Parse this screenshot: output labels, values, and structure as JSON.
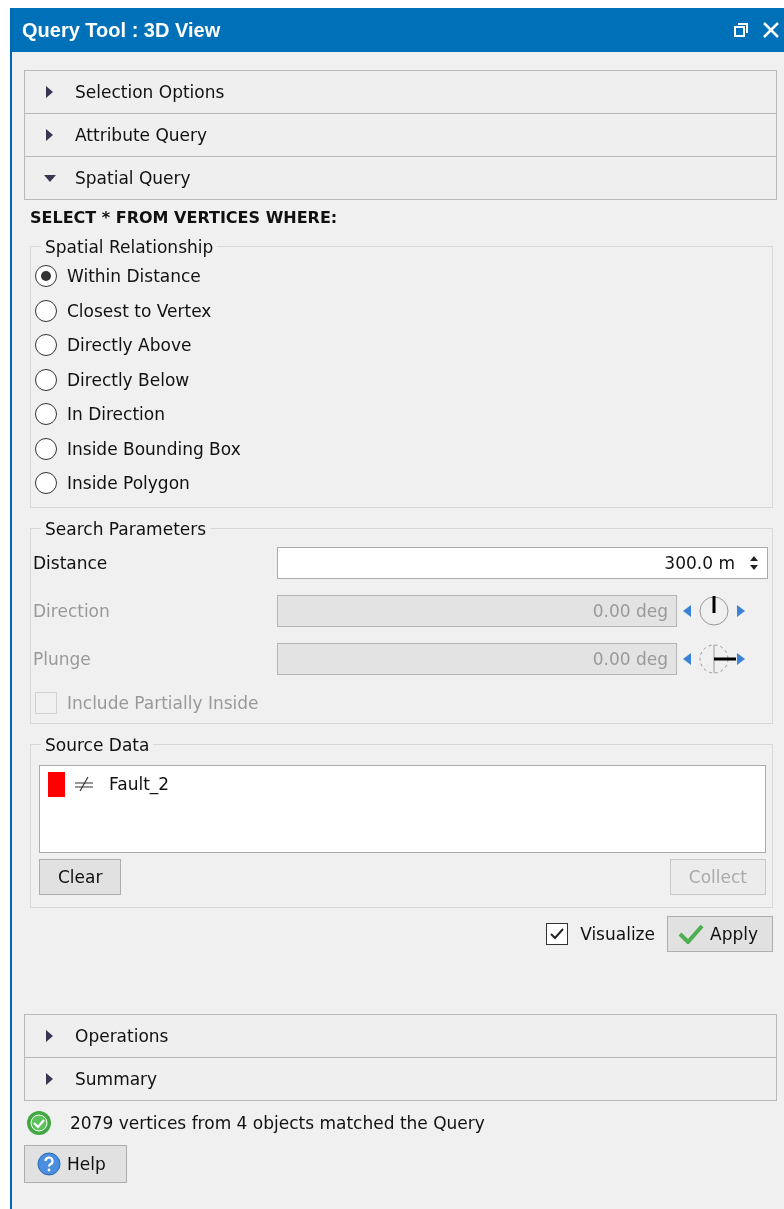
{
  "window": {
    "title": "Query Tool : 3D View"
  },
  "sections_top": [
    {
      "label": "Selection Options",
      "expanded": false
    },
    {
      "label": "Attribute Query",
      "expanded": false
    },
    {
      "label": "Spatial Query",
      "expanded": true
    }
  ],
  "query_label": "SELECT * FROM VERTICES WHERE:",
  "spatial_relationship": {
    "legend": "Spatial Relationship",
    "options": [
      {
        "label": "Within Distance",
        "selected": true
      },
      {
        "label": "Closest to Vertex",
        "selected": false
      },
      {
        "label": "Directly Above",
        "selected": false
      },
      {
        "label": "Directly Below",
        "selected": false
      },
      {
        "label": "In Direction",
        "selected": false
      },
      {
        "label": "Inside Bounding Box",
        "selected": false
      },
      {
        "label": "Inside Polygon",
        "selected": false
      }
    ]
  },
  "search_parameters": {
    "legend": "Search Parameters",
    "fields": [
      {
        "kind": "spin",
        "label": "Distance",
        "value": "300.0 m",
        "disabled": false
      },
      {
        "kind": "direction",
        "label": "Direction",
        "value": "0.00 deg",
        "disabled": true
      },
      {
        "kind": "plunge",
        "label": "Plunge",
        "value": "0.00 deg",
        "disabled": true
      }
    ],
    "include_partially_inside": {
      "label": "Include Partially Inside",
      "checked": false,
      "disabled": true
    }
  },
  "source_data": {
    "legend": "Source Data",
    "items": [
      {
        "name": "Fault_2",
        "color": "#ff0000"
      }
    ],
    "buttons": [
      {
        "label": "Clear",
        "disabled": false
      },
      {
        "label": "Collect",
        "disabled": true
      }
    ]
  },
  "visualize": {
    "label": "Visualize",
    "checked": true
  },
  "apply": {
    "label": "Apply"
  },
  "sections_bottom": [
    {
      "label": "Operations",
      "expanded": false
    },
    {
      "label": "Summary",
      "expanded": false
    }
  ],
  "status": {
    "text": "2079 vertices from 4 objects matched the Query"
  },
  "help": {
    "label": "Help"
  }
}
